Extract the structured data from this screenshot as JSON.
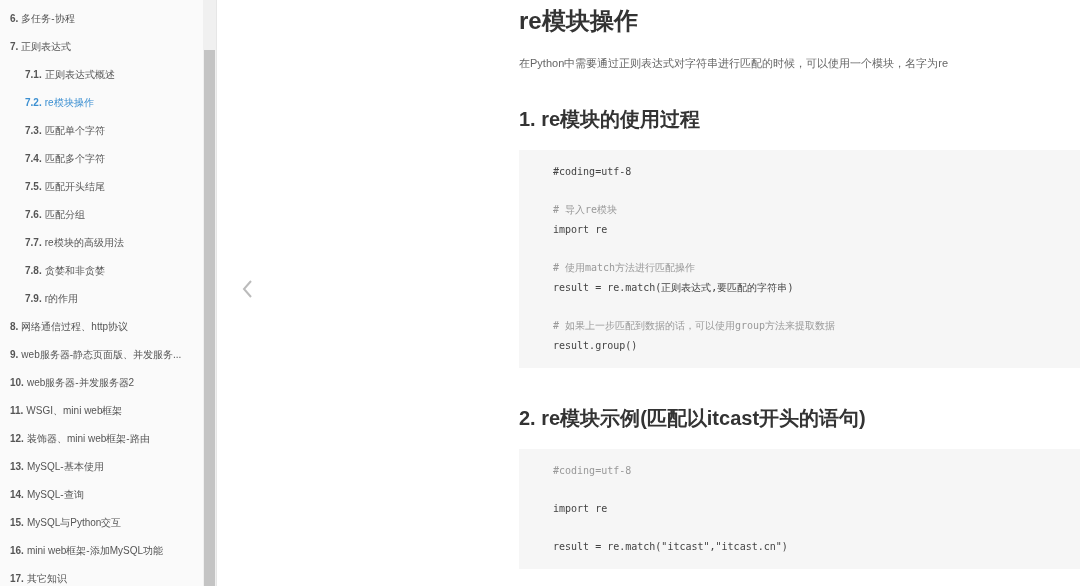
{
  "sidebar": {
    "items": [
      {
        "number": "6.",
        "title": "多任务-协程",
        "selected": false
      },
      {
        "number": "7.",
        "title": "正则表达式",
        "selected": false,
        "children": [
          {
            "number": "7.1.",
            "title": "正则表达式概述",
            "selected": false
          },
          {
            "number": "7.2.",
            "title": "re模块操作",
            "selected": true
          },
          {
            "number": "7.3.",
            "title": "匹配单个字符",
            "selected": false
          },
          {
            "number": "7.4.",
            "title": "匹配多个字符",
            "selected": false
          },
          {
            "number": "7.5.",
            "title": "匹配开头结尾",
            "selected": false
          },
          {
            "number": "7.6.",
            "title": "匹配分组",
            "selected": false
          },
          {
            "number": "7.7.",
            "title": "re模块的高级用法",
            "selected": false
          },
          {
            "number": "7.8.",
            "title": "贪婪和非贪婪",
            "selected": false
          },
          {
            "number": "7.9.",
            "title": "r的作用",
            "selected": false
          }
        ]
      },
      {
        "number": "8.",
        "title": "网络通信过程、http协议",
        "selected": false
      },
      {
        "number": "9.",
        "title": "web服务器-静态页面版、并发服务...",
        "selected": false
      },
      {
        "number": "10.",
        "title": "web服务器-并发服务器2",
        "selected": false
      },
      {
        "number": "11.",
        "title": "WSGI、mini web框架",
        "selected": false
      },
      {
        "number": "12.",
        "title": "装饰器、mini web框架-路由",
        "selected": false
      },
      {
        "number": "13.",
        "title": "MySQL-基本使用",
        "selected": false
      },
      {
        "number": "14.",
        "title": "MySQL-查询",
        "selected": false
      },
      {
        "number": "15.",
        "title": "MySQL与Python交互",
        "selected": false
      },
      {
        "number": "16.",
        "title": "mini web框架-添加MySQL功能",
        "selected": false
      },
      {
        "number": "17.",
        "title": "其它知识",
        "selected": false
      }
    ]
  },
  "article": {
    "title": "re模块操作",
    "intro": "在Python中需要通过正则表达式对字符串进行匹配的时候，可以使用一个模块，名字为re",
    "sections": [
      {
        "heading": "1. re模块的使用过程",
        "code_groups": [
          [
            {
              "kind": "code",
              "text": "#coding=utf-8"
            }
          ],
          [
            {
              "kind": "comment",
              "text": "# 导入re模块"
            },
            {
              "kind": "code",
              "text": "import re"
            }
          ],
          [
            {
              "kind": "comment",
              "text": "# 使用match方法进行匹配操作"
            },
            {
              "kind": "code",
              "text": "result = re.match(正则表达式,要匹配的字符串)"
            }
          ],
          [
            {
              "kind": "comment",
              "text": "# 如果上一步匹配到数据的话，可以使用group方法来提取数据"
            },
            {
              "kind": "code",
              "text": "result.group()"
            }
          ]
        ]
      },
      {
        "heading": "2. re模块示例(匹配以itcast开头的语句)",
        "code_groups": [
          [
            {
              "kind": "comment",
              "text": "#coding=utf-8"
            }
          ],
          [
            {
              "kind": "code",
              "text": "import re"
            }
          ],
          [
            {
              "kind": "code",
              "text": "result = re.match(\"itcast\",\"itcast.cn\")"
            }
          ]
        ]
      }
    ]
  }
}
